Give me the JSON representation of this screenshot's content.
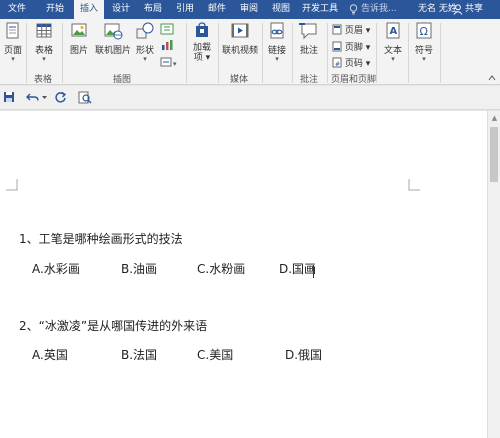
{
  "tabs": [
    {
      "label": "文件",
      "active": false
    },
    {
      "label": "开始",
      "active": false
    },
    {
      "label": "插入",
      "active": true
    },
    {
      "label": "设计",
      "active": false
    },
    {
      "label": "布局",
      "active": false
    },
    {
      "label": "引用",
      "active": false
    },
    {
      "label": "邮件",
      "active": false
    },
    {
      "label": "审阅",
      "active": false
    },
    {
      "label": "视图",
      "active": false
    },
    {
      "label": "开发工具",
      "active": false
    }
  ],
  "tell_me": "告诉我...",
  "user": "无名 无姓",
  "share": "共享",
  "ribbon": {
    "pages": "页面",
    "table": "表格",
    "picture": "图片",
    "online_picture": "联机图片",
    "shapes": "形状",
    "addins": "加载\n项",
    "online_video": "联机视频",
    "link": "链接",
    "comment": "批注",
    "header": "页眉",
    "footer": "页脚",
    "page_number": "页码",
    "textbox": "文本",
    "symbol": "符号",
    "groups": {
      "table": "表格",
      "illustrations": "插图",
      "media": "媒体",
      "comments": "批注",
      "header_footer": "页眉和页脚"
    }
  },
  "document": {
    "q1": "1、工笔是哪种绘画形式的技法",
    "q1_options": [
      "A.水彩画",
      "B.油画",
      "C.水粉画",
      "D.国画"
    ],
    "q2": "2、“冰激凌”是从哪国传进的外来语",
    "q2_options": [
      "A.英国",
      "B.法国",
      "C.美国",
      "D.俄国"
    ]
  },
  "colors": {
    "accent": "#2b579a",
    "ribbon_bg": "#f3f3f3"
  }
}
